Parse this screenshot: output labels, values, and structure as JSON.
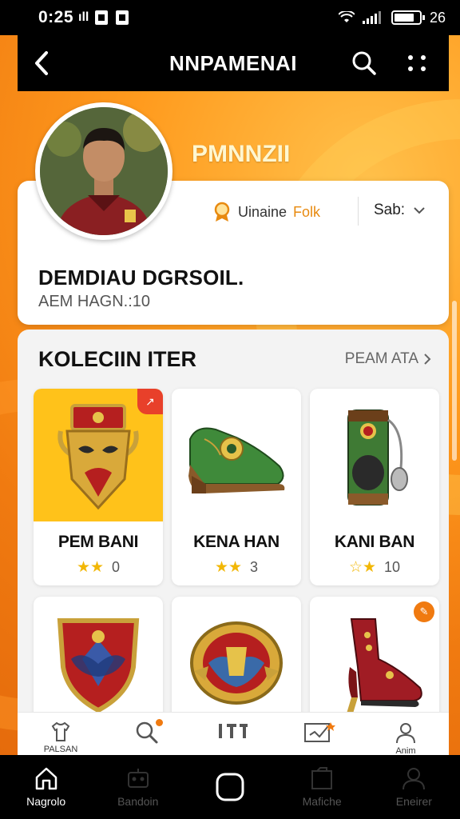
{
  "status_bar": {
    "time": "0:25",
    "signal": "ıll",
    "battery_text": "26"
  },
  "app_bar": {
    "title": "NNPAMENAI"
  },
  "profile": {
    "display_name": "PMNNZII",
    "favorite_label_1": "Uinaine",
    "favorite_label_2": "Folk",
    "sort_label": "Sab:",
    "title": "DEMDIAU DGRSOIL.",
    "subtitle": "AEM HAGN.:10"
  },
  "collection": {
    "title": "KOLECIIN ITER",
    "see_all": "PEAM ATA",
    "items": [
      {
        "name": "PEM BANI",
        "stars": "★★",
        "count": "0",
        "badge": "↗"
      },
      {
        "name": "KENA HAN",
        "stars": "★★",
        "count": "3"
      },
      {
        "name": "KANI BAN",
        "stars": "☆★",
        "count": "10"
      },
      {
        "name": "",
        "stars": "",
        "count": ""
      },
      {
        "name": "",
        "stars": "",
        "count": ""
      },
      {
        "name": "",
        "stars": "",
        "count": "",
        "badge": "✎"
      }
    ]
  },
  "secondary_nav": {
    "items": [
      {
        "label": "PALSAN",
        "icon": "shirt-icon"
      },
      {
        "label": "",
        "icon": "search-icon"
      },
      {
        "label": "",
        "icon": "columns-icon"
      },
      {
        "label": "",
        "icon": "chart-icon"
      },
      {
        "label": "Anim",
        "icon": "profile-icon"
      }
    ]
  },
  "bottom_nav": {
    "items": [
      {
        "label": "Nagrolo",
        "icon": "home-icon",
        "active": true
      },
      {
        "label": "Bandoin",
        "icon": "robot-icon",
        "active": false
      },
      {
        "label": "",
        "icon": "home-button-icon",
        "active": false
      },
      {
        "label": "Mafiche",
        "icon": "bag-icon",
        "active": false
      },
      {
        "label": "Eneirer",
        "icon": "person-icon",
        "active": false
      }
    ]
  },
  "colors": {
    "accent": "#f07a10",
    "bar": "#000000",
    "star": "#f2b705"
  }
}
